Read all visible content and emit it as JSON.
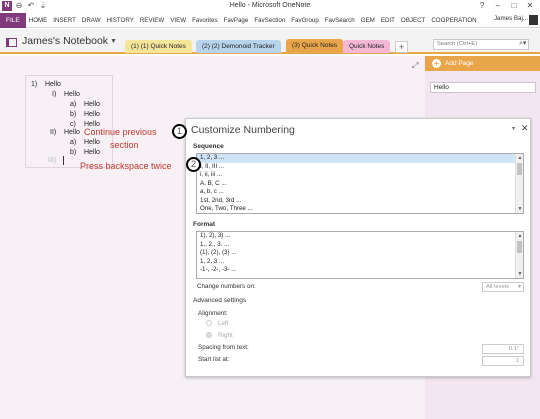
{
  "window": {
    "title": "Hello - Microsoft OneNote",
    "app_icon": "N",
    "controls": [
      "?",
      "–",
      "□",
      "✕"
    ]
  },
  "quick_access": [
    "back-icon",
    "undo-icon",
    "pin-icon"
  ],
  "ribbon": {
    "file": "FILE",
    "tabs": [
      "HOME",
      "INSERT",
      "DRAW",
      "HISTORY",
      "REVIEW",
      "VIEW",
      "Favorites",
      "FavPage",
      "FavSection",
      "FavGroup",
      "FavSearch",
      "GEM",
      "EDIT",
      "OBJECT",
      "COOPERATION"
    ],
    "user": "James Baj..."
  },
  "notebook": {
    "name": "James's Notebook",
    "sections": [
      {
        "label": "(1) (1) Quick Notes",
        "color": "#f6e69a"
      },
      {
        "label": "(2) (2) Demonoid Tracker",
        "color": "#b8d4ec"
      },
      {
        "label": "(3) Quick Notes",
        "color": "#e9a54a"
      },
      {
        "label": "Quick Notes",
        "color": "#f5b7d4"
      }
    ],
    "add_section": "+",
    "search_placeholder": "Search (Ctrl+E)",
    "search_icon": "⌕▾"
  },
  "outline": [
    {
      "marker": "1)",
      "text": "Hello"
    },
    {
      "marker": "I)",
      "text": "Hello"
    },
    {
      "marker": "a)",
      "text": "Hello"
    },
    {
      "marker": "b)",
      "text": "Hello"
    },
    {
      "marker": "c)",
      "text": "Hello"
    },
    {
      "marker": "II)",
      "text": "Hello"
    },
    {
      "marker": "a)",
      "text": "Hello"
    },
    {
      "marker": "b)",
      "text": "Hello"
    },
    {
      "marker": "III)",
      "text": ""
    }
  ],
  "annotations": {
    "a1_line1": "Continue previous",
    "a1_line2": "section",
    "a2": "Press backspace twice",
    "circle1": "1",
    "circle2": "2"
  },
  "side_panel": {
    "add_page": "Add Page",
    "pages": [
      "Hello"
    ]
  },
  "dialog": {
    "title": "Customize Numbering",
    "close": "✕",
    "caret": "▾",
    "sequence_label": "Sequence",
    "sequence_items": [
      "1, 2, 3 ...",
      "I, II, III ...",
      "i, ii, iii ...",
      "A, B, C ...",
      "a, b, c ...",
      "1st, 2nd, 3rd ...",
      "One, Two, Three ..."
    ],
    "format_label": "Format",
    "format_items": [
      "1), 2), 3) ...",
      "1., 2., 3. ...",
      "(1), (2), (3) ...",
      "1, 2, 3 ...",
      "-1-, -2-, -3- ..."
    ],
    "change_numbers_label": "Change numbers on:",
    "change_numbers_value": "All levels",
    "advanced_label": "Advanced settings",
    "alignment_label": "Alignment:",
    "align_left": "Left",
    "align_right": "Right",
    "spacing_label": "Spacing from text:",
    "spacing_value": "0.1\"",
    "start_label": "Start list at:",
    "start_value": "1"
  }
}
